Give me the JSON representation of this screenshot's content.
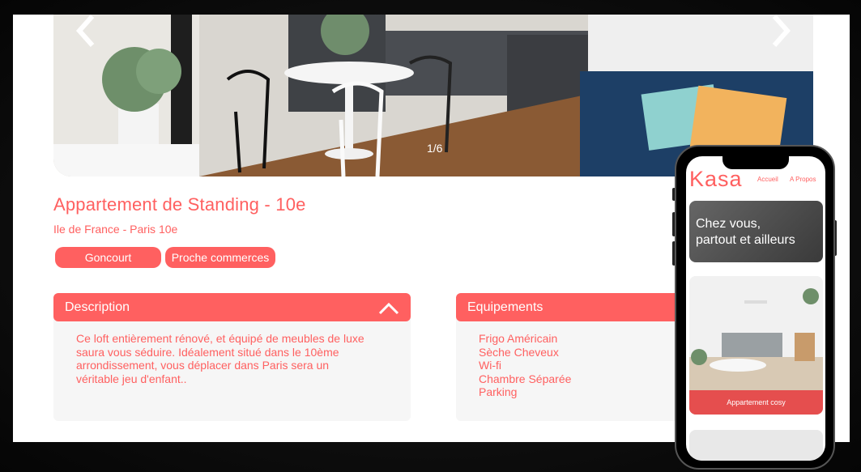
{
  "gallery": {
    "counter": "1/6"
  },
  "listing": {
    "title": "Appartement de Standing - 10e",
    "location": "Ile de France - Paris 10e",
    "tags": [
      "Goncourt",
      "Proche commerces"
    ]
  },
  "description": {
    "label": "Description",
    "lines": [
      "Ce loft entièrement rénové, et équipé de meubles de luxe",
      "saura vous séduire. Idéalement situé dans le 10ème",
      "arrondissement, vous déplacer dans Paris sera un",
      "véritable jeu d'enfant.."
    ]
  },
  "equipements": {
    "label": "Equipements",
    "items": [
      "Frigo Américain",
      "Sèche Cheveux",
      "Wi-fi",
      "Chambre Séparée",
      "Parking"
    ]
  },
  "mobile": {
    "logo": "Kasa",
    "nav": [
      "Accueil",
      "A Propos"
    ],
    "hero_line1": "Chez vous,",
    "hero_line2": "partout et ailleurs",
    "card_title": "Appartement cosy"
  },
  "colors": {
    "accent": "#ff6060",
    "panel_bg": "#f6f6f6"
  }
}
